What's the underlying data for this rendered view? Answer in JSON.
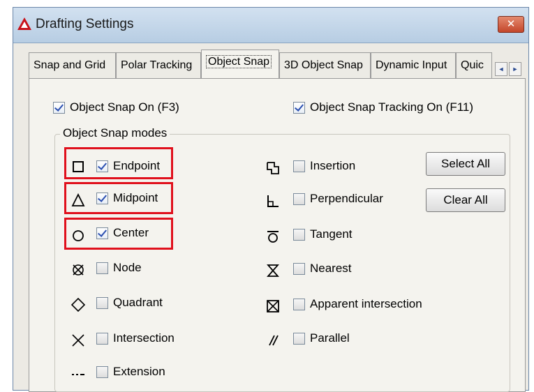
{
  "window": {
    "title": "Drafting Settings",
    "close_label": "✕"
  },
  "tabs": [
    {
      "label": "Snap and Grid"
    },
    {
      "label": "Polar Tracking"
    },
    {
      "label": "Object Snap"
    },
    {
      "label": "3D Object Snap"
    },
    {
      "label": "Dynamic Input"
    },
    {
      "label": "Quic"
    }
  ],
  "tab_scroll": {
    "left": "◄",
    "right": "►"
  },
  "snap_on": {
    "label": "Object Snap On (F3)",
    "checked": true
  },
  "tracking_on": {
    "label": "Object Snap Tracking On (F11)",
    "checked": true
  },
  "modes_title": "Object Snap modes",
  "left_modes": [
    {
      "label": "Endpoint",
      "checked": true,
      "icon": "endpoint-square-icon"
    },
    {
      "label": "Midpoint",
      "checked": true,
      "icon": "midpoint-triangle-icon"
    },
    {
      "label": "Center",
      "checked": true,
      "icon": "center-circle-icon"
    },
    {
      "label": "Node",
      "checked": false,
      "icon": "node-icon"
    },
    {
      "label": "Quadrant",
      "checked": false,
      "icon": "quadrant-diamond-icon"
    },
    {
      "label": "Intersection",
      "checked": false,
      "icon": "intersection-x-icon"
    },
    {
      "label": "Extension",
      "checked": false,
      "icon": "extension-dashes-icon"
    }
  ],
  "right_modes": [
    {
      "label": "Insertion",
      "checked": false,
      "icon": "insertion-icon"
    },
    {
      "label": "Perpendicular",
      "checked": false,
      "icon": "perpendicular-icon"
    },
    {
      "label": "Tangent",
      "checked": false,
      "icon": "tangent-icon"
    },
    {
      "label": "Nearest",
      "checked": false,
      "icon": "nearest-hourglass-icon"
    },
    {
      "label": "Apparent intersection",
      "checked": false,
      "icon": "apparent-intersection-icon"
    },
    {
      "label": "Parallel",
      "checked": false,
      "icon": "parallel-icon"
    }
  ],
  "buttons": {
    "select_all": "Select All",
    "clear_all": "Clear All"
  },
  "colors": {
    "highlight": "#e0101c",
    "check": "#2a4fb0",
    "title_bar": "#c5d8ec"
  }
}
